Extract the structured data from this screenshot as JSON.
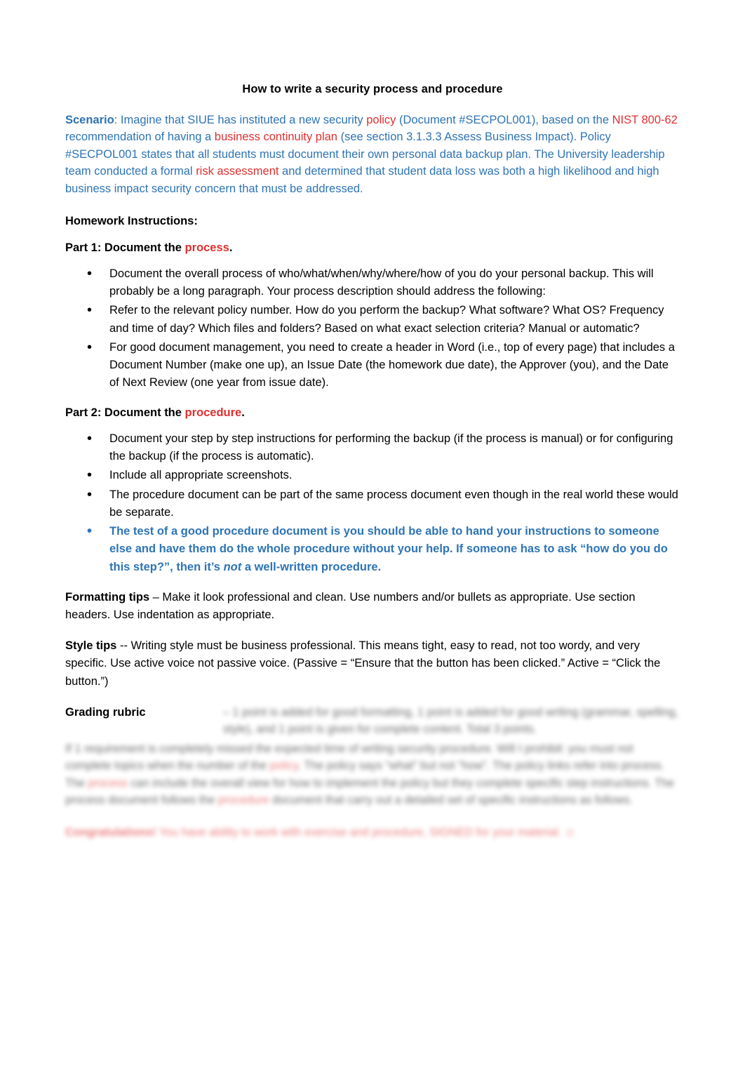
{
  "document": {
    "title": "How to write a security process and procedure",
    "scenario": {
      "label": "Scenario",
      "part1": ": Imagine that SIUE has instituted a new security ",
      "policy_word": "policy",
      "part2": " (Document #SECPOL001), based on the ",
      "nist": "NIST 800-62",
      "part3": " recommendation of having a ",
      "bcp": "business continuity plan",
      "part4": " (see section 3.1.3.3 Assess Business Impact). Policy #SECPOL001 states that all students must document their own personal data backup plan. The University leadership team conducted a formal ",
      "risk": "risk assessment",
      "part5": " and determined that student data loss was both a high likelihood and high business impact security concern that must be addressed."
    },
    "homework_heading": "Homework Instructions:",
    "part1": {
      "heading_prefix": "Part 1: Document the ",
      "heading_keyword": "process",
      "heading_suffix": ".",
      "bullets": [
        "Document the overall process of who/what/when/why/where/how of you do your personal backup. This will probably be a long paragraph. Your process description should address the following:",
        "Refer to the relevant policy number. How do you perform the backup? What software? What OS? Frequency and time of day? Which files and folders? Based on what exact selection criteria? Manual or automatic?",
        "For good document management, you need to create a header in Word (i.e., top of every page) that includes a Document Number (make one up), an Issue Date (the homework due date), the Approver (you), and the Date of Next Review (one year from issue date)."
      ]
    },
    "part2": {
      "heading_prefix": "Part 2: Document the ",
      "heading_keyword": "procedure",
      "heading_suffix": ".",
      "bullets": [
        "Document your step by step instructions for performing the backup (if the process is manual) or for configuring the backup (if the process is automatic).",
        "Include all appropriate screenshots.",
        "The procedure document can be part of the same process document even though in the real world these would be separate."
      ],
      "emphasis_bullet": {
        "part1": "The test of a good procedure document is you should be able to hand your instructions to someone else and have them do the whole procedure without your help. If someone has to ask “how do you do this step?”, then it’s ",
        "italic": "not",
        "part2": " a well-written procedure."
      }
    },
    "formatting_tips": {
      "label": "Formatting tips",
      "text": " – Make it look professional and clean. Use numbers and/or bullets as appropriate. Use section headers. Use indentation as appropriate."
    },
    "style_tips": {
      "label": "Style tips",
      "text": " -- Writing style must be business professional.  This means tight, easy to read, not too wordy, and very specific. Use active voice not passive voice. (Passive = “Ensure that the button has been clicked.” Active = “Click the button.”)"
    },
    "grading_rubric": {
      "label": "Grading rubric",
      "inline_text": " – 1 point is added for good formatting, 1 point is added for good writing (grammar, spelling, style), and 1 point is given for complete content. Total 3 points.",
      "paragraph1_a": "If 1 requirement is completely missed the expected time of writing security procedure. Will I prohibit: you must not complete topics when the number of the ",
      "paragraph1_red": "policy",
      "paragraph1_b": ". The policy says “what” but not “how”. The policy links refer into process.  The ",
      "paragraph1_red2": "process",
      "paragraph1_c": " can include the overall view for how to implement the policy but they complete specific step instructions.  The process document follows the ",
      "paragraph1_red3": "procedure",
      "paragraph1_d": " document that carry out a detailed set of specific instructions as follows.",
      "paragraph2_red_bold": "Congratulations!",
      "paragraph2_red": " You have ability to work with exercise and procedure, SIGNED for your material. ☺"
    }
  }
}
